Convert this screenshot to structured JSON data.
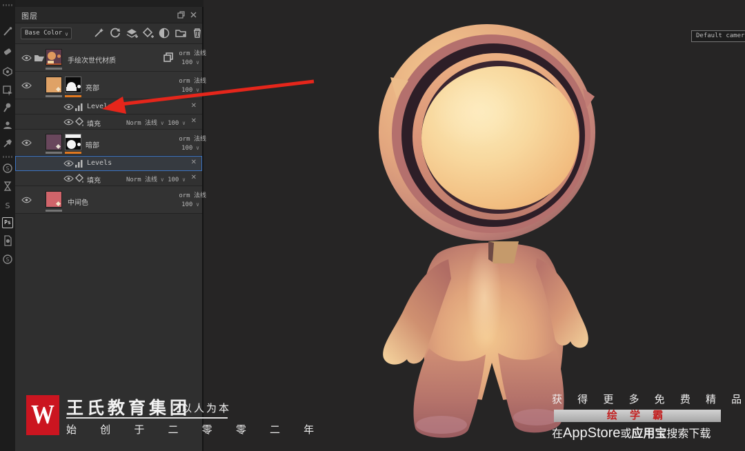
{
  "sidebar": {
    "ps_label": "Ps"
  },
  "panel": {
    "title": "图层",
    "filter": {
      "value": "Base Color"
    },
    "rows": {
      "group": {
        "name": "手绘次世代材质",
        "blend": "orm 法线",
        "opacity": "100"
      },
      "light": {
        "name": "亮部",
        "blend": "orm 法线",
        "opacity": "100"
      },
      "light_levels": {
        "name": "Levels"
      },
      "light_fill": {
        "name": "填充",
        "blend": "Norm 法线",
        "opacity": "100"
      },
      "dark": {
        "name": "暗部",
        "blend": "orm 法线",
        "opacity": "100"
      },
      "dark_levels": {
        "name": "Levels"
      },
      "dark_fill": {
        "name": "填充",
        "blend": "Norm 法线",
        "opacity": "100"
      },
      "mid": {
        "name": "中间色",
        "blend": "orm 法线",
        "opacity": "100"
      }
    }
  },
  "viewport": {
    "camera_label": "Default camera"
  },
  "branding": {
    "logo_letter": "W",
    "company": "王氏教育集团",
    "slogan": "以人为本",
    "since": "始 创 于 二 零 零 二 年",
    "logo_color": "#cb1520"
  },
  "promo": {
    "line1": "获 得 更 多 免 费 精 品 教 程",
    "banner": "绘 学 霸",
    "banner_text_color": "#c32020",
    "line3_prefix": "在",
    "line3_store": "AppStore",
    "line3_or": "或",
    "line3_store2": "应用宝",
    "line3_suffix": "搜索下载"
  },
  "colors": {
    "selection_blue": "#3c74c2",
    "annotation_arrow": "#e5261b",
    "mask_strip_orange": "#e07820"
  }
}
